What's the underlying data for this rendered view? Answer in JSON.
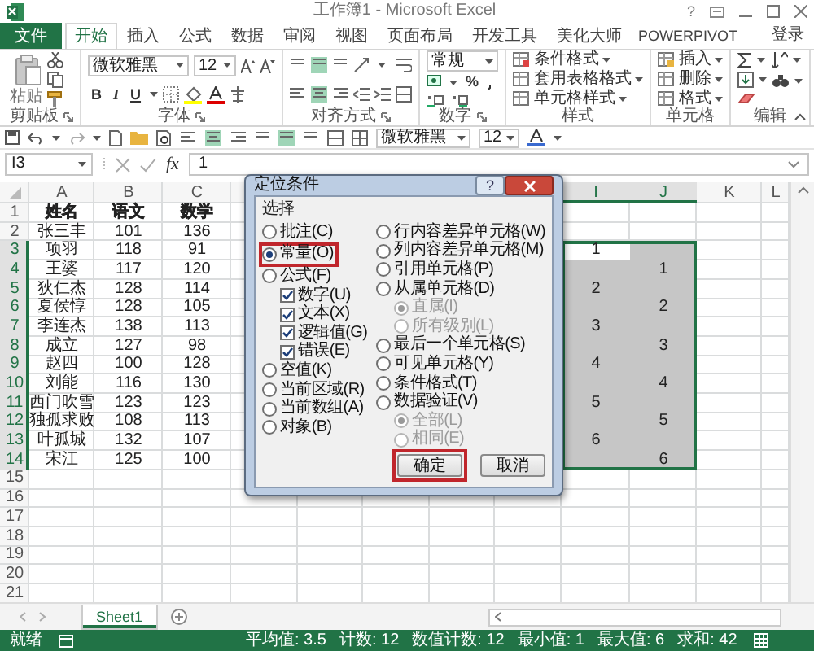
{
  "window": {
    "title": "工作簿1 - Microsoft Excel",
    "help": "?"
  },
  "ribbon": {
    "tabs": [
      {
        "label": "文件",
        "kind": "file",
        "selected": false
      },
      {
        "label": "开始",
        "kind": "tab",
        "selected": true
      },
      {
        "label": "插入",
        "kind": "tab",
        "selected": false
      },
      {
        "label": "公式",
        "kind": "tab",
        "selected": false
      },
      {
        "label": "数据",
        "kind": "tab",
        "selected": false
      },
      {
        "label": "审阅",
        "kind": "tab",
        "selected": false
      },
      {
        "label": "视图",
        "kind": "tab",
        "selected": false
      },
      {
        "label": "页面布局",
        "kind": "tab",
        "selected": false
      },
      {
        "label": "开发工具",
        "kind": "tab",
        "selected": false
      },
      {
        "label": "美化大师",
        "kind": "tab",
        "selected": false
      },
      {
        "label": "POWERPIVOT",
        "kind": "tab",
        "selected": false
      }
    ],
    "account": "登录",
    "groups": [
      {
        "kind": "clipboard",
        "label": "剪贴板",
        "paste": "粘贴"
      },
      {
        "kind": "font",
        "label": "字体",
        "font": "微软雅黑",
        "size": "12",
        "bold": "B",
        "italic": "I",
        "underline": "U"
      },
      {
        "kind": "alignment",
        "label": "对齐方式",
        "vertical": [
          {
            "selected": false
          },
          {
            "selected": true
          },
          {
            "selected": false
          }
        ],
        "horizontal": [
          {
            "selected": false
          },
          {
            "selected": true
          },
          {
            "selected": false
          }
        ]
      },
      {
        "kind": "number",
        "label": "数字",
        "format": "常规",
        "percent": "%"
      },
      {
        "kind": "styles",
        "label": "样式",
        "commands": [
          "条件格式",
          "套用表格格式",
          "单元格样式"
        ]
      },
      {
        "kind": "cells",
        "label": "单元格",
        "commands": [
          "插入",
          "删除",
          "格式"
        ]
      },
      {
        "kind": "editing",
        "label": "编辑"
      }
    ]
  },
  "quick_access": {
    "font": "微软雅黑",
    "size": "12",
    "vertical": [
      {
        "selected": false
      },
      {
        "selected": true
      },
      {
        "selected": false
      }
    ],
    "horizontal": [
      {
        "selected": false
      },
      {
        "selected": true
      },
      {
        "selected": false
      }
    ]
  },
  "formula_bar": {
    "name_box": "I3",
    "fx": "fx",
    "formula": "1"
  },
  "sheet": {
    "columns": [
      {
        "kind": "header",
        "label": "A",
        "selected": false
      },
      {
        "kind": "header",
        "label": "B",
        "selected": false
      },
      {
        "kind": "header",
        "label": "C",
        "selected": false
      },
      {
        "kind": "covered"
      },
      {
        "kind": "covered"
      },
      {
        "kind": "covered"
      },
      {
        "kind": "covered"
      },
      {
        "kind": "covered"
      },
      {
        "kind": "header",
        "label": "I",
        "selected": true
      },
      {
        "kind": "header",
        "label": "J",
        "selected": true
      },
      {
        "kind": "header",
        "label": "K",
        "selected": false
      },
      {
        "kind": "header",
        "label": "L",
        "selected": false
      }
    ],
    "rows": [
      {
        "header": "1",
        "selected": false,
        "bold": true,
        "column_a": "姓名",
        "column_b": "语文",
        "column_c": "数学"
      },
      {
        "header": "2",
        "selected": false,
        "bold": false,
        "column_a": "张三丰",
        "column_b": "101",
        "column_c": "136"
      },
      {
        "header": "3",
        "selected": true,
        "bold": false,
        "column_a": "项羽",
        "column_b": "118",
        "column_c": "91",
        "column_i": {
          "text": "1",
          "selected": true,
          "active": true
        },
        "column_j": {
          "selected": true,
          "active": false
        }
      },
      {
        "header": "4",
        "selected": true,
        "bold": false,
        "column_a": "王婆",
        "column_b": "117",
        "column_c": "120",
        "column_i": {
          "selected": true,
          "active": false
        },
        "column_j": {
          "text": "1",
          "selected": true,
          "active": false
        }
      },
      {
        "header": "5",
        "selected": true,
        "bold": false,
        "column_a": "狄仁杰",
        "column_b": "128",
        "column_c": "114",
        "column_i": {
          "text": "2",
          "selected": true,
          "active": false
        },
        "column_j": {
          "selected": true,
          "active": false
        }
      },
      {
        "header": "6",
        "selected": true,
        "bold": false,
        "column_a": "夏侯惇",
        "column_b": "128",
        "column_c": "105",
        "column_i": {
          "selected": true,
          "active": false
        },
        "column_j": {
          "text": "2",
          "selected": true,
          "active": false
        }
      },
      {
        "header": "7",
        "selected": true,
        "bold": false,
        "column_a": "李连杰",
        "column_b": "138",
        "column_c": "113",
        "column_i": {
          "text": "3",
          "selected": true,
          "active": false
        },
        "column_j": {
          "selected": true,
          "active": false
        }
      },
      {
        "header": "8",
        "selected": true,
        "bold": false,
        "column_a": "成立",
        "column_b": "127",
        "column_c": "98",
        "column_i": {
          "selected": true,
          "active": false
        },
        "column_j": {
          "text": "3",
          "selected": true,
          "active": false
        }
      },
      {
        "header": "9",
        "selected": true,
        "bold": false,
        "column_a": "赵四",
        "column_b": "100",
        "column_c": "128",
        "column_i": {
          "text": "4",
          "selected": true,
          "active": false
        },
        "column_j": {
          "selected": true,
          "active": false
        }
      },
      {
        "header": "10",
        "selected": true,
        "bold": false,
        "column_a": "刘能",
        "column_b": "116",
        "column_c": "130",
        "column_i": {
          "selected": true,
          "active": false
        },
        "column_j": {
          "text": "4",
          "selected": true,
          "active": false
        }
      },
      {
        "header": "11",
        "selected": true,
        "bold": false,
        "column_a": "西门吹雪",
        "column_b": "123",
        "column_c": "123",
        "column_i": {
          "text": "5",
          "selected": true,
          "active": false
        },
        "column_j": {
          "selected": true,
          "active": false
        }
      },
      {
        "header": "12",
        "selected": true,
        "bold": false,
        "column_a": "独孤求败",
        "column_b": "108",
        "column_c": "113",
        "column_i": {
          "selected": true,
          "active": false
        },
        "column_j": {
          "text": "5",
          "selected": true,
          "active": false
        }
      },
      {
        "header": "13",
        "selected": true,
        "bold": false,
        "column_a": "叶孤城",
        "column_b": "132",
        "column_c": "107",
        "column_i": {
          "text": "6",
          "selected": true,
          "active": false
        },
        "column_j": {
          "selected": true,
          "active": false
        }
      },
      {
        "header": "14",
        "selected": true,
        "bold": false,
        "column_a": "宋江",
        "column_b": "125",
        "column_c": "100",
        "column_i": {
          "selected": true,
          "active": false
        },
        "column_j": {
          "text": "6",
          "selected": true,
          "active": false
        }
      },
      {
        "header": "15",
        "selected": false
      },
      {
        "header": "16",
        "selected": false
      },
      {
        "header": "17",
        "selected": false
      },
      {
        "header": "18",
        "selected": false
      },
      {
        "header": "19",
        "selected": false
      },
      {
        "header": "20",
        "selected": false
      },
      {
        "header": "21",
        "selected": false
      }
    ]
  },
  "dialog": {
    "title": "定位条件",
    "help": "?",
    "section": "选择",
    "left": [
      {
        "kind": "radio",
        "label": "批注(C)",
        "selected": false,
        "disabled": false,
        "highlighted": false
      },
      {
        "kind": "radio",
        "label": "常量(O)",
        "selected": true,
        "disabled": false,
        "highlighted": true
      },
      {
        "kind": "radio",
        "label": "公式(F)",
        "selected": false,
        "disabled": false,
        "highlighted": false
      },
      {
        "kind": "checkbox",
        "label": "数字(U)",
        "checked": true,
        "disabled": false,
        "highlighted": false
      },
      {
        "kind": "checkbox",
        "label": "文本(X)",
        "checked": true,
        "disabled": false,
        "highlighted": false
      },
      {
        "kind": "checkbox",
        "label": "逻辑值(G)",
        "checked": true,
        "disabled": false,
        "highlighted": false
      },
      {
        "kind": "checkbox",
        "label": "错误(E)",
        "checked": true,
        "disabled": false,
        "highlighted": false
      },
      {
        "kind": "radio",
        "label": "空值(K)",
        "selected": false,
        "disabled": false,
        "highlighted": false
      },
      {
        "kind": "radio",
        "label": "当前区域(R)",
        "selected": false,
        "disabled": false,
        "highlighted": false
      },
      {
        "kind": "radio",
        "label": "当前数组(A)",
        "selected": false,
        "disabled": false,
        "highlighted": false
      },
      {
        "kind": "radio",
        "label": "对象(B)",
        "selected": false,
        "disabled": false,
        "highlighted": false
      }
    ],
    "right": [
      {
        "kind": "radio",
        "label": "行内容差异单元格(W)",
        "selected": false,
        "disabled": false,
        "highlighted": false
      },
      {
        "kind": "radio",
        "label": "列内容差异单元格(M)",
        "selected": false,
        "disabled": false,
        "highlighted": false
      },
      {
        "kind": "radio",
        "label": "引用单元格(P)",
        "selected": false,
        "disabled": false,
        "highlighted": false
      },
      {
        "kind": "radio",
        "label": "从属单元格(D)",
        "selected": false,
        "disabled": false,
        "highlighted": false
      },
      {
        "kind": "subradio",
        "label": "直属(I)",
        "selected": true,
        "disabled": true,
        "highlighted": false
      },
      {
        "kind": "subradio",
        "label": "所有级别(L)",
        "selected": false,
        "disabled": true,
        "highlighted": false
      },
      {
        "kind": "radio",
        "label": "最后一个单元格(S)",
        "selected": false,
        "disabled": false,
        "highlighted": false
      },
      {
        "kind": "radio",
        "label": "可见单元格(Y)",
        "selected": false,
        "disabled": false,
        "highlighted": false
      },
      {
        "kind": "radio",
        "label": "条件格式(T)",
        "selected": false,
        "disabled": false,
        "highlighted": false
      },
      {
        "kind": "radio",
        "label": "数据验证(V)",
        "selected": false,
        "disabled": false,
        "highlighted": false
      },
      {
        "kind": "subradio",
        "label": "全部(L)",
        "selected": true,
        "disabled": true,
        "highlighted": false
      },
      {
        "kind": "subradio",
        "label": "相同(E)",
        "selected": false,
        "disabled": true,
        "highlighted": false
      }
    ],
    "buttons": [
      {
        "label": "确定",
        "highlighted": true
      },
      {
        "label": "取消",
        "highlighted": false
      }
    ]
  },
  "sheet_tabs": [
    {
      "label": "Sheet1",
      "selected": true
    }
  ],
  "status_bar": {
    "state": "就绪",
    "stats": [
      "平均值: 3.5",
      "计数: 12",
      "数值计数: 12",
      "最小值: 1",
      "最大值: 6",
      "求和: 42"
    ]
  }
}
